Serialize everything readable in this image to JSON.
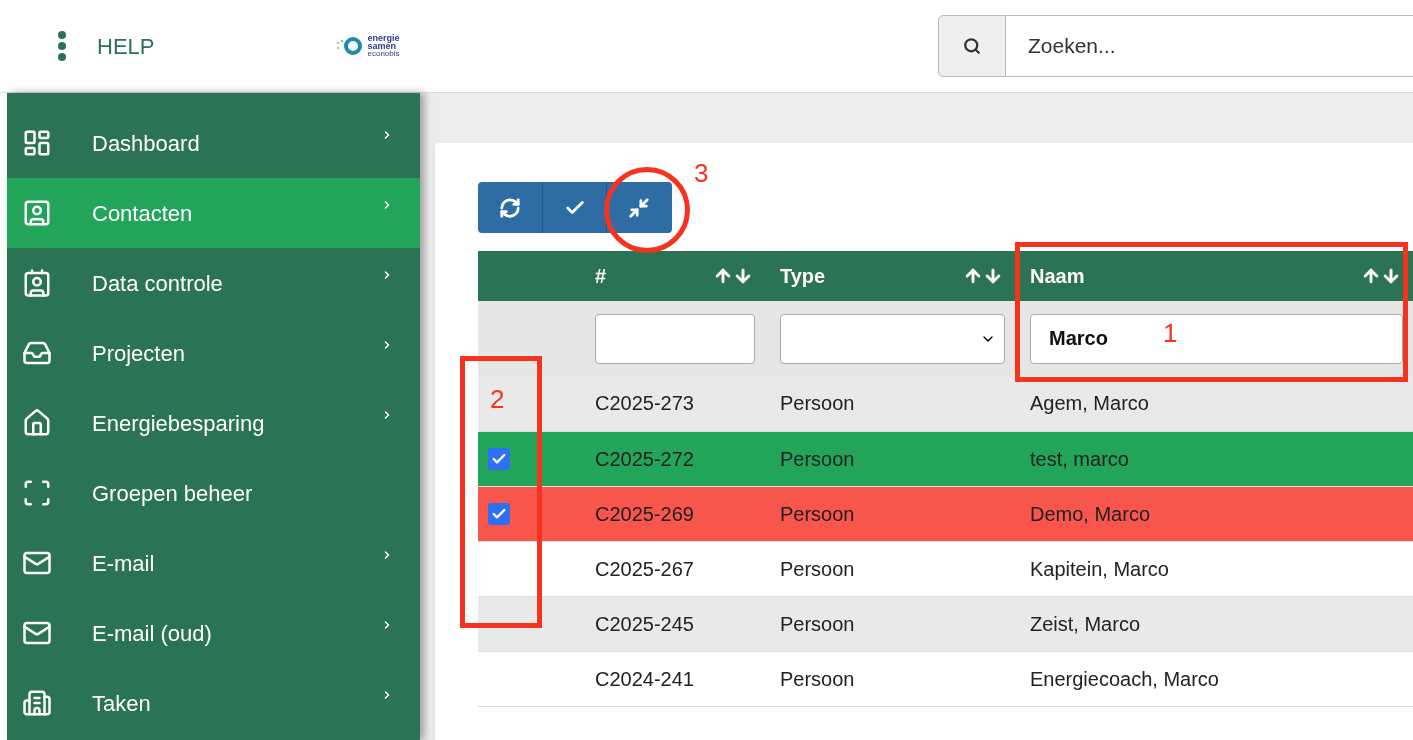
{
  "header": {
    "help": "HELP",
    "logo": {
      "line1": "energie",
      "line2": "samen",
      "line3": "econobis"
    },
    "search": {
      "placeholder": "Zoeken..."
    }
  },
  "sidebar": {
    "items": [
      {
        "label": "Dashboard",
        "selected": false,
        "has_submenu": true
      },
      {
        "label": "Contacten",
        "selected": true,
        "has_submenu": true
      },
      {
        "label": "Data controle",
        "selected": false,
        "has_submenu": true
      },
      {
        "label": "Projecten",
        "selected": false,
        "has_submenu": true
      },
      {
        "label": "Energiebesparing",
        "selected": false,
        "has_submenu": true
      },
      {
        "label": "Groepen beheer",
        "selected": false,
        "has_submenu": false
      },
      {
        "label": "E-mail",
        "selected": false,
        "has_submenu": true
      },
      {
        "label": "E-mail (oud)",
        "selected": false,
        "has_submenu": true
      },
      {
        "label": "Taken",
        "selected": false,
        "has_submenu": true
      }
    ]
  },
  "table": {
    "columns": [
      {
        "label": "#",
        "filter": {
          "kind": "text"
        }
      },
      {
        "label": "Type",
        "filter": {
          "kind": "select"
        }
      },
      {
        "label": "Naam",
        "filter": {
          "kind": "text",
          "value": "Marco"
        }
      }
    ],
    "rows": [
      {
        "cells": [
          "C2025-273",
          "Persoon",
          "Agem, Marco"
        ],
        "checked": false
      },
      {
        "cells": [
          "C2025-272",
          "Persoon",
          "test, marco"
        ],
        "checked": true,
        "color": "#22a45a"
      },
      {
        "cells": [
          "C2025-269",
          "Persoon",
          "Demo, Marco"
        ],
        "checked": true,
        "color": "#f8554c"
      },
      {
        "cells": [
          "C2025-267",
          "Persoon",
          "Kapitein, Marco"
        ],
        "checked": false
      },
      {
        "cells": [
          "C2025-245",
          "Persoon",
          "Zeist, Marco"
        ],
        "checked": false
      },
      {
        "cells": [
          "C2024-241",
          "Persoon",
          "Energiecoach, Marco"
        ],
        "checked": false
      }
    ]
  },
  "annotations": [
    {
      "kind": "box",
      "label": "1"
    },
    {
      "kind": "box",
      "label": "2"
    },
    {
      "kind": "circle",
      "label": "3"
    }
  ]
}
